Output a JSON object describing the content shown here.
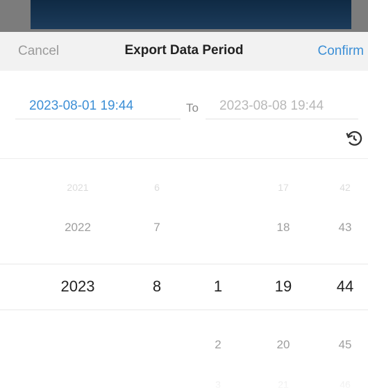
{
  "header": {
    "cancel_label": "Cancel",
    "title": "Export Data Period",
    "confirm_label": "Confirm"
  },
  "range": {
    "start": "2023-08-01 19:44",
    "to_label": "To",
    "end": "2023-08-08 19:44"
  },
  "picker": {
    "columns": [
      {
        "name": "year",
        "far": "2021",
        "prev": "2022",
        "selected": "2023",
        "next": "",
        "next2": ""
      },
      {
        "name": "month",
        "far": "6",
        "prev": "7",
        "selected": "8",
        "next": "",
        "next2": ""
      },
      {
        "name": "day",
        "far": "",
        "prev": "",
        "selected": "1",
        "next": "2",
        "next2": "3"
      },
      {
        "name": "hour",
        "far": "17",
        "prev": "18",
        "selected": "19",
        "next": "20",
        "next2": "21"
      },
      {
        "name": "minute",
        "far": "42",
        "prev": "43",
        "selected": "44",
        "next": "45",
        "next2": "46"
      }
    ]
  },
  "icons": {
    "reset": "reset-icon"
  },
  "colors": {
    "accent": "#3c8fd6",
    "header_bg": "#f2f2f2"
  }
}
